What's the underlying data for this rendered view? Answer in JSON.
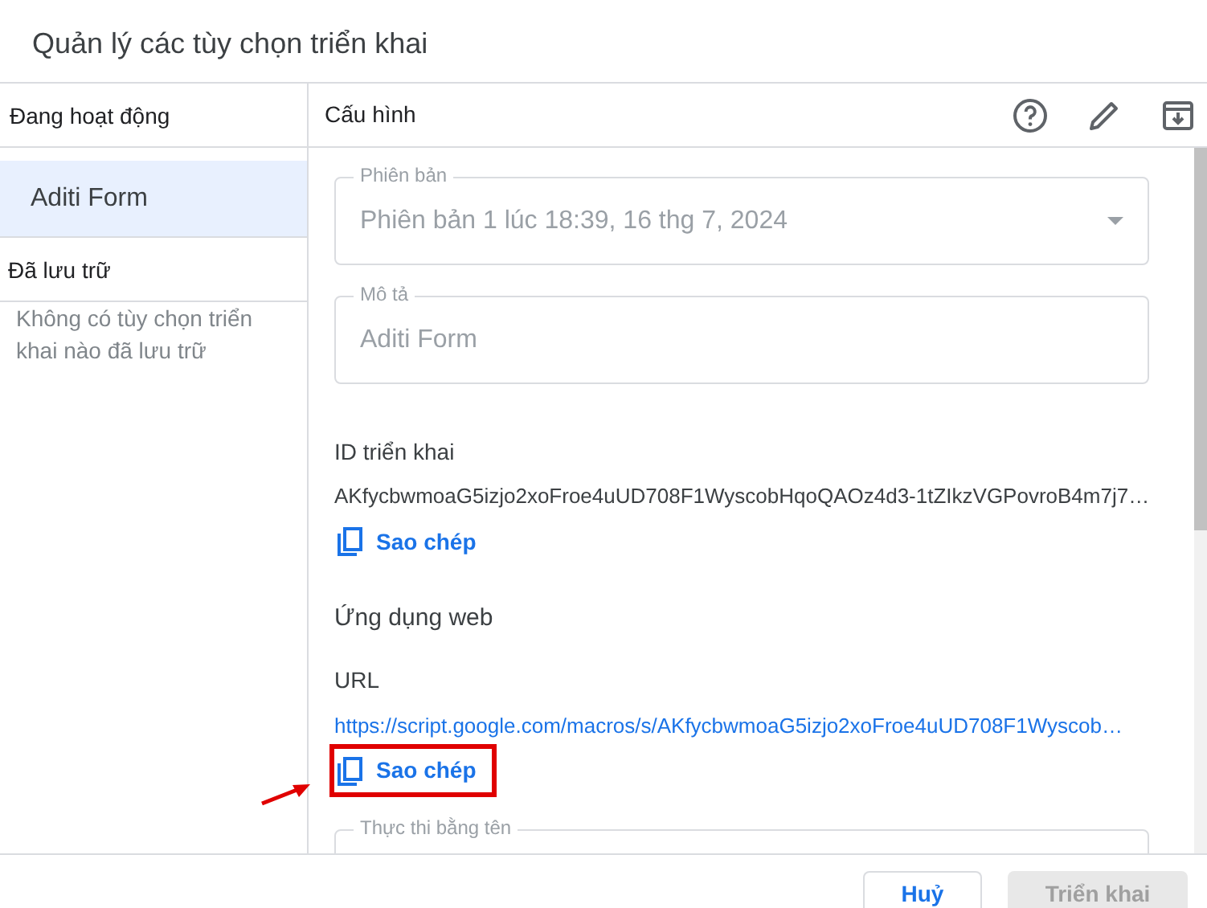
{
  "dialog": {
    "title": "Quản lý các tùy chọn triển khai"
  },
  "sidebar": {
    "active_heading": "Đang hoạt động",
    "active_items": [
      {
        "label": "Aditi Form",
        "selected": true
      }
    ],
    "archived_heading": "Đã lưu trữ",
    "archived_empty": "Không có tùy chọn triển khai nào đã lưu trữ"
  },
  "config": {
    "heading": "Cấu hình",
    "fields": [
      {
        "label": "Phiên bản",
        "value": "Phiên bản 1 lúc 18:39, 16 thg 7, 2024",
        "kind": "select",
        "disabled": true
      },
      {
        "label": "Mô tả",
        "value": "Aditi Form",
        "kind": "text",
        "disabled": true
      }
    ],
    "deployment_id": {
      "label": "ID triển khai",
      "value": "AKfycbwmoaG5izjo2xoFroe4uUD708F1WyscobHqoQAOz4d3-1tZIkzVGPovroB4m7j7…",
      "copy": {
        "label": "Sao chép",
        "highlighted": false
      }
    },
    "web_app": {
      "heading": "Ứng dụng web",
      "url_label": "URL",
      "url": "https://script.google.com/macros/s/AKfycbwmoaG5izjo2xoFroe4uUD708F1Wyscob…",
      "copy": {
        "label": "Sao chép",
        "highlighted": true
      },
      "execute_as": {
        "label": "Thực thi bằng tên"
      }
    }
  },
  "buttons": [
    {
      "label": "Huỷ",
      "disabled": false
    },
    {
      "label": "Triển khai",
      "disabled": true
    }
  ]
}
